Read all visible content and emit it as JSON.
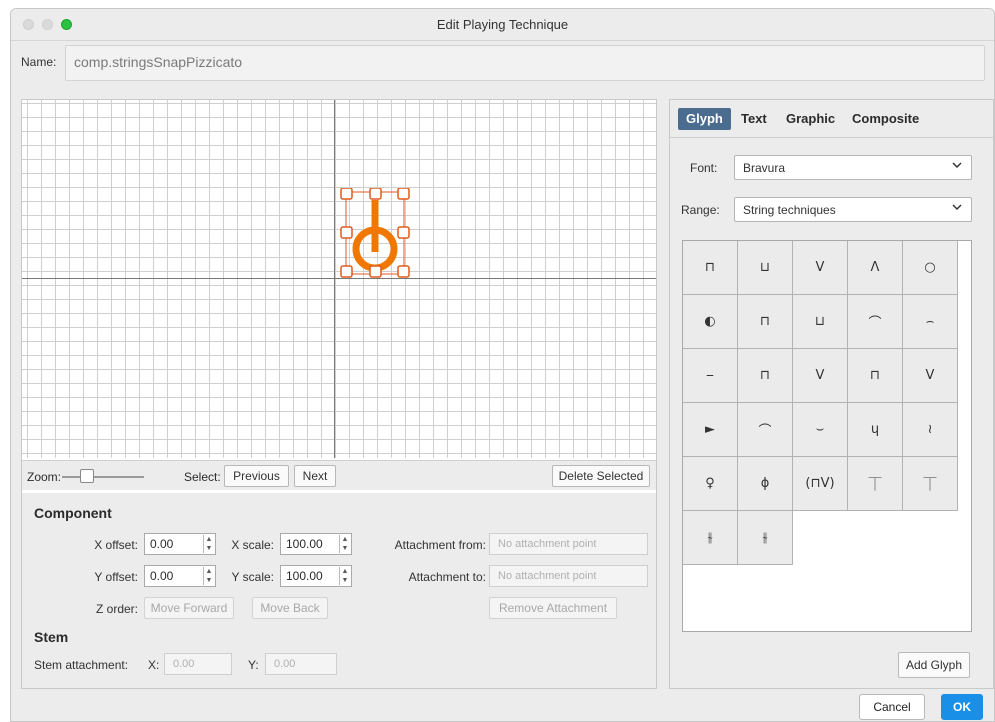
{
  "window": {
    "title": "Edit Playing Technique"
  },
  "name": {
    "label": "Name:",
    "value": "comp.stringsSnapPizzicato"
  },
  "editor": {
    "glyph_color": "#f07800",
    "zoom_label": "Zoom:",
    "select_label": "Select:",
    "previous_label": "Previous",
    "next_label": "Next",
    "delete_selected_label": "Delete Selected"
  },
  "component": {
    "title": "Component",
    "x_offset_label": "X offset:",
    "x_offset_value": "0.00",
    "y_offset_label": "Y offset:",
    "y_offset_value": "0.00",
    "x_scale_label": "X scale:",
    "x_scale_value": "100.00",
    "y_scale_label": "Y scale:",
    "y_scale_value": "100.00",
    "z_order_label": "Z order:",
    "move_forward_label": "Move Forward",
    "move_back_label": "Move Back",
    "attach_from_label": "Attachment from:",
    "attach_from_value": "No attachment point",
    "attach_to_label": "Attachment to:",
    "attach_to_value": "No attachment point",
    "remove_attachment_label": "Remove Attachment"
  },
  "stem": {
    "title": "Stem",
    "attachment_label": "Stem attachment:",
    "x_label": "X:",
    "x_value": "0.00",
    "y_label": "Y:",
    "y_value": "0.00"
  },
  "right": {
    "tabs": [
      {
        "label": "Glyph",
        "active": true
      },
      {
        "label": "Text",
        "active": false
      },
      {
        "label": "Graphic",
        "active": false
      },
      {
        "label": "Composite",
        "active": false
      }
    ],
    "font_label": "Font:",
    "font_value": "Bravura",
    "range_label": "Range:",
    "range_value": "String techniques",
    "glyphs": [
      "⊓",
      "⊔",
      "V",
      "Λ",
      "○",
      "◐",
      "⊓",
      "⊔",
      "⌒",
      "⌢",
      "⎯",
      "⊓",
      "V",
      "⊓",
      "V",
      "►",
      "⌒",
      "⌣",
      "ɥ",
      "≀",
      "♀",
      "ϕ",
      "(⊓V)",
      "⏉",
      "⏉",
      "⫳",
      "⫳"
    ],
    "glyph_names": [
      "down-bow-icon",
      "up-bow-icon",
      "up-bow-alt-icon",
      "down-bow-alt-icon",
      "harmonic-circle-icon",
      "half-harmonic-icon",
      "down-bow-small-icon",
      "up-bow-small-icon",
      "arc-icon",
      "arc-flat-icon",
      "dash-icon",
      "down-bow-stroke-icon",
      "v-stroke-icon",
      "down-bow-stroke-alt-icon",
      "v-double-icon",
      "triangle-right-icon",
      "arc-dots-icon",
      "smile-dots-icon",
      "h-mark-icon",
      "wave-icon",
      "open-pizz-icon",
      "thumb-pos-icon",
      "bow-pair-icon",
      "chop-icon",
      "chop-alt-icon",
      "scrape-icon",
      "scrape-alt-icon"
    ],
    "add_glyph_label": "Add Glyph"
  },
  "footer": {
    "cancel_label": "Cancel",
    "ok_label": "OK"
  }
}
